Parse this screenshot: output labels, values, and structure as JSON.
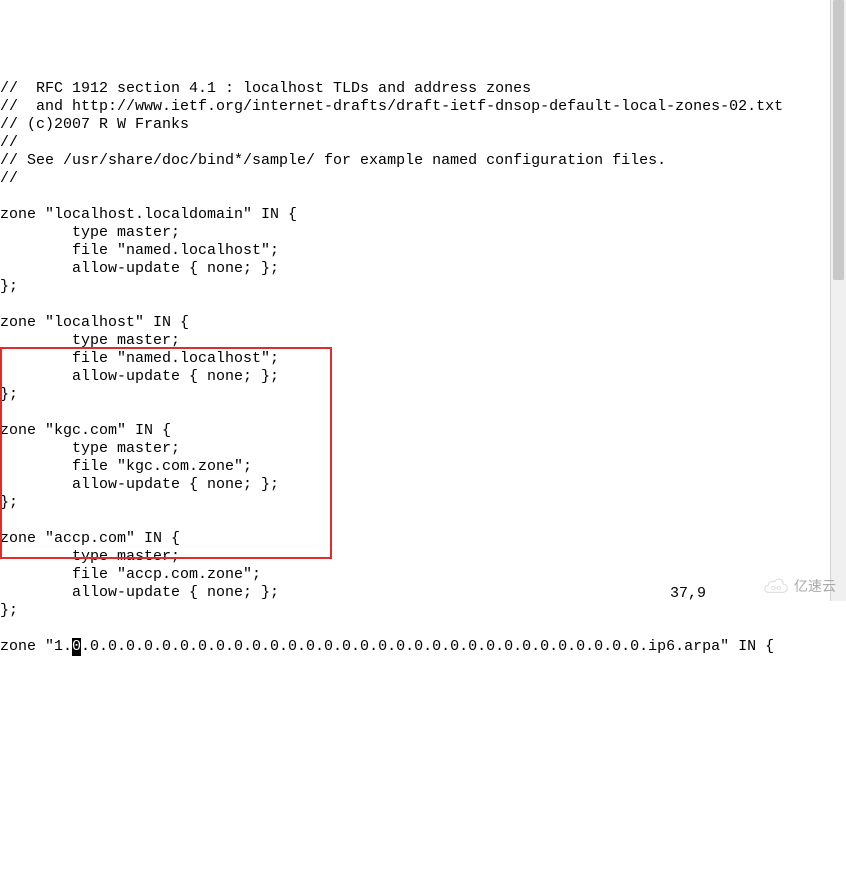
{
  "config": {
    "lines": [
      "//  RFC 1912 section 4.1 : localhost TLDs and address zones",
      "//  and http://www.ietf.org/internet-drafts/draft-ietf-dnsop-default-local-zones-02.txt",
      "// (c)2007 R W Franks",
      "//",
      "// See /usr/share/doc/bind*/sample/ for example named configuration files.",
      "//",
      "",
      "zone \"localhost.localdomain\" IN {",
      "        type master;",
      "        file \"named.localhost\";",
      "        allow-update { none; };",
      "};",
      "",
      "zone \"localhost\" IN {",
      "        type master;",
      "        file \"named.localhost\";",
      "        allow-update { none; };",
      "};",
      "",
      "zone \"kgc.com\" IN {",
      "        type master;",
      "        file \"kgc.com.zone\";",
      "        allow-update { none; };",
      "};",
      "",
      "zone \"accp.com\" IN {",
      "        type master;",
      "        file \"accp.com.zone\";",
      "        allow-update { none; };",
      "};",
      ""
    ],
    "last_line_before_cursor": "zone \"1.",
    "cursor_char": "0",
    "last_line_after_cursor": ".0.0.0.0.0.0.0.0.0.0.0.0.0.0.0.0.0.0.0.0.0.0.0.0.0.0.0.0.0.0.0.ip6.arpa\" IN {",
    "status": "37,9"
  },
  "watermark": {
    "text": "亿速云"
  }
}
